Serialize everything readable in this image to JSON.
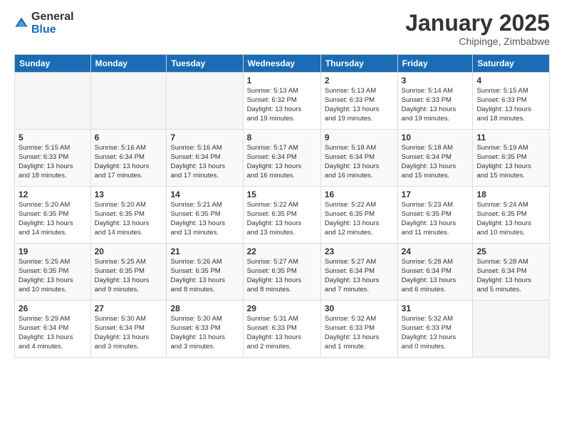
{
  "logo": {
    "general": "General",
    "blue": "Blue"
  },
  "title": "January 2025",
  "location": "Chipinge, Zimbabwe",
  "weekdays": [
    "Sunday",
    "Monday",
    "Tuesday",
    "Wednesday",
    "Thursday",
    "Friday",
    "Saturday"
  ],
  "weeks": [
    [
      {
        "num": "",
        "info": ""
      },
      {
        "num": "",
        "info": ""
      },
      {
        "num": "",
        "info": ""
      },
      {
        "num": "1",
        "info": "Sunrise: 5:13 AM\nSunset: 6:32 PM\nDaylight: 13 hours\nand 19 minutes."
      },
      {
        "num": "2",
        "info": "Sunrise: 5:13 AM\nSunset: 6:33 PM\nDaylight: 13 hours\nand 19 minutes."
      },
      {
        "num": "3",
        "info": "Sunrise: 5:14 AM\nSunset: 6:33 PM\nDaylight: 13 hours\nand 19 minutes."
      },
      {
        "num": "4",
        "info": "Sunrise: 5:15 AM\nSunset: 6:33 PM\nDaylight: 13 hours\nand 18 minutes."
      }
    ],
    [
      {
        "num": "5",
        "info": "Sunrise: 5:15 AM\nSunset: 6:33 PM\nDaylight: 13 hours\nand 18 minutes."
      },
      {
        "num": "6",
        "info": "Sunrise: 5:16 AM\nSunset: 6:34 PM\nDaylight: 13 hours\nand 17 minutes."
      },
      {
        "num": "7",
        "info": "Sunrise: 5:16 AM\nSunset: 6:34 PM\nDaylight: 13 hours\nand 17 minutes."
      },
      {
        "num": "8",
        "info": "Sunrise: 5:17 AM\nSunset: 6:34 PM\nDaylight: 13 hours\nand 16 minutes."
      },
      {
        "num": "9",
        "info": "Sunrise: 5:18 AM\nSunset: 6:34 PM\nDaylight: 13 hours\nand 16 minutes."
      },
      {
        "num": "10",
        "info": "Sunrise: 5:18 AM\nSunset: 6:34 PM\nDaylight: 13 hours\nand 15 minutes."
      },
      {
        "num": "11",
        "info": "Sunrise: 5:19 AM\nSunset: 6:35 PM\nDaylight: 13 hours\nand 15 minutes."
      }
    ],
    [
      {
        "num": "12",
        "info": "Sunrise: 5:20 AM\nSunset: 6:35 PM\nDaylight: 13 hours\nand 14 minutes."
      },
      {
        "num": "13",
        "info": "Sunrise: 5:20 AM\nSunset: 6:35 PM\nDaylight: 13 hours\nand 14 minutes."
      },
      {
        "num": "14",
        "info": "Sunrise: 5:21 AM\nSunset: 6:35 PM\nDaylight: 13 hours\nand 13 minutes."
      },
      {
        "num": "15",
        "info": "Sunrise: 5:22 AM\nSunset: 6:35 PM\nDaylight: 13 hours\nand 13 minutes."
      },
      {
        "num": "16",
        "info": "Sunrise: 5:22 AM\nSunset: 6:35 PM\nDaylight: 13 hours\nand 12 minutes."
      },
      {
        "num": "17",
        "info": "Sunrise: 5:23 AM\nSunset: 6:35 PM\nDaylight: 13 hours\nand 11 minutes."
      },
      {
        "num": "18",
        "info": "Sunrise: 5:24 AM\nSunset: 6:35 PM\nDaylight: 13 hours\nand 10 minutes."
      }
    ],
    [
      {
        "num": "19",
        "info": "Sunrise: 5:25 AM\nSunset: 6:35 PM\nDaylight: 13 hours\nand 10 minutes."
      },
      {
        "num": "20",
        "info": "Sunrise: 5:25 AM\nSunset: 6:35 PM\nDaylight: 13 hours\nand 9 minutes."
      },
      {
        "num": "21",
        "info": "Sunrise: 5:26 AM\nSunset: 6:35 PM\nDaylight: 13 hours\nand 8 minutes."
      },
      {
        "num": "22",
        "info": "Sunrise: 5:27 AM\nSunset: 6:35 PM\nDaylight: 13 hours\nand 8 minutes."
      },
      {
        "num": "23",
        "info": "Sunrise: 5:27 AM\nSunset: 6:34 PM\nDaylight: 13 hours\nand 7 minutes."
      },
      {
        "num": "24",
        "info": "Sunrise: 5:28 AM\nSunset: 6:34 PM\nDaylight: 13 hours\nand 6 minutes."
      },
      {
        "num": "25",
        "info": "Sunrise: 5:28 AM\nSunset: 6:34 PM\nDaylight: 13 hours\nand 5 minutes."
      }
    ],
    [
      {
        "num": "26",
        "info": "Sunrise: 5:29 AM\nSunset: 6:34 PM\nDaylight: 13 hours\nand 4 minutes."
      },
      {
        "num": "27",
        "info": "Sunrise: 5:30 AM\nSunset: 6:34 PM\nDaylight: 13 hours\nand 3 minutes."
      },
      {
        "num": "28",
        "info": "Sunrise: 5:30 AM\nSunset: 6:33 PM\nDaylight: 13 hours\nand 3 minutes."
      },
      {
        "num": "29",
        "info": "Sunrise: 5:31 AM\nSunset: 6:33 PM\nDaylight: 13 hours\nand 2 minutes."
      },
      {
        "num": "30",
        "info": "Sunrise: 5:32 AM\nSunset: 6:33 PM\nDaylight: 13 hours\nand 1 minute."
      },
      {
        "num": "31",
        "info": "Sunrise: 5:32 AM\nSunset: 6:33 PM\nDaylight: 13 hours\nand 0 minutes."
      },
      {
        "num": "",
        "info": ""
      }
    ]
  ]
}
